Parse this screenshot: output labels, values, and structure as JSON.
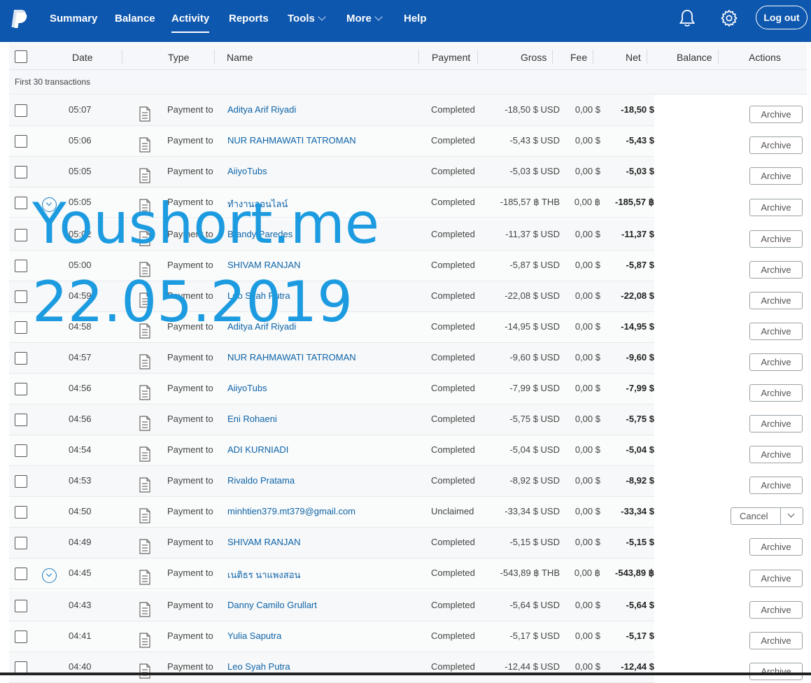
{
  "nav": {
    "items": [
      {
        "label": "Summary",
        "active": false,
        "dropdown": false
      },
      {
        "label": "Balance",
        "active": false,
        "dropdown": false
      },
      {
        "label": "Activity",
        "active": true,
        "dropdown": false
      },
      {
        "label": "Reports",
        "active": false,
        "dropdown": false
      },
      {
        "label": "Tools",
        "active": false,
        "dropdown": true
      },
      {
        "label": "More",
        "active": false,
        "dropdown": true
      },
      {
        "label": "Help",
        "active": false,
        "dropdown": false
      }
    ],
    "icons": [
      "paypal-logo-icon",
      "bell-icon",
      "gear-icon"
    ],
    "logout_label": "Log out",
    "bar_color": "#0e57ae"
  },
  "table": {
    "headers": {
      "date": "Date",
      "type": "Type",
      "name": "Name",
      "payment": "Payment",
      "gross": "Gross",
      "fee": "Fee",
      "net": "Net",
      "balance": "Balance",
      "actions": "Actions"
    },
    "subheader": "First 30 transactions",
    "rows": [
      {
        "time": "05:07",
        "type": "Payment to",
        "name": "Aditya Arif Riyadi",
        "status": "Completed",
        "gross": "-18,50 $ USD",
        "fee": "0,00 $",
        "net": "-18,50 $",
        "action": "Archive",
        "expandable": false
      },
      {
        "time": "05:06",
        "type": "Payment to",
        "name": "NUR RAHMAWATI TATROMAN",
        "status": "Completed",
        "gross": "-5,43 $ USD",
        "fee": "0,00 $",
        "net": "-5,43 $",
        "action": "Archive",
        "expandable": false
      },
      {
        "time": "05:05",
        "type": "Payment to",
        "name": "AiiyoTubs",
        "status": "Completed",
        "gross": "-5,03 $ USD",
        "fee": "0,00 $",
        "net": "-5,03 $",
        "action": "Archive",
        "expandable": false
      },
      {
        "time": "05:05",
        "type": "Payment to",
        "name": "ทำงานออนไลน์",
        "status": "Completed",
        "gross": "-185,57 ฿ THB",
        "fee": "0,00 ฿",
        "net": "-185,57 ฿",
        "action": "Archive",
        "expandable": true
      },
      {
        "time": "05:02",
        "type": "Payment to",
        "name": "Brandy Paredes",
        "status": "Completed",
        "gross": "-11,37 $ USD",
        "fee": "0,00 $",
        "net": "-11,37 $",
        "action": "Archive",
        "expandable": false
      },
      {
        "time": "05:00",
        "type": "Payment to",
        "name": "SHIVAM RANJAN",
        "status": "Completed",
        "gross": "-5,87 $ USD",
        "fee": "0,00 $",
        "net": "-5,87 $",
        "action": "Archive",
        "expandable": false
      },
      {
        "time": "04:59",
        "type": "Payment to",
        "name": "Leo Syah Putra",
        "status": "Completed",
        "gross": "-22,08 $ USD",
        "fee": "0,00 $",
        "net": "-22,08 $",
        "action": "Archive",
        "expandable": false
      },
      {
        "time": "04:58",
        "type": "Payment to",
        "name": "Aditya Arif Riyadi",
        "status": "Completed",
        "gross": "-14,95 $ USD",
        "fee": "0,00 $",
        "net": "-14,95 $",
        "action": "Archive",
        "expandable": false
      },
      {
        "time": "04:57",
        "type": "Payment to",
        "name": "NUR RAHMAWATI TATROMAN",
        "status": "Completed",
        "gross": "-9,60 $ USD",
        "fee": "0,00 $",
        "net": "-9,60 $",
        "action": "Archive",
        "expandable": false
      },
      {
        "time": "04:56",
        "type": "Payment to",
        "name": "AiiyoTubs",
        "status": "Completed",
        "gross": "-7,99 $ USD",
        "fee": "0,00 $",
        "net": "-7,99 $",
        "action": "Archive",
        "expandable": false
      },
      {
        "time": "04:56",
        "type": "Payment to",
        "name": "Eni Rohaeni",
        "status": "Completed",
        "gross": "-5,75 $ USD",
        "fee": "0,00 $",
        "net": "-5,75 $",
        "action": "Archive",
        "expandable": false
      },
      {
        "time": "04:54",
        "type": "Payment to",
        "name": "ADI KURNIADI",
        "status": "Completed",
        "gross": "-5,04 $ USD",
        "fee": "0,00 $",
        "net": "-5,04 $",
        "action": "Archive",
        "expandable": false
      },
      {
        "time": "04:53",
        "type": "Payment to",
        "name": "Rivaldo Pratama",
        "status": "Completed",
        "gross": "-8,92 $ USD",
        "fee": "0,00 $",
        "net": "-8,92 $",
        "action": "Archive",
        "expandable": false
      },
      {
        "time": "04:50",
        "type": "Payment to",
        "name": "minhtien379.mt379@gmail.com",
        "status": "Unclaimed",
        "gross": "-33,34 $ USD",
        "fee": "0,00 $",
        "net": "-33,34 $",
        "action": "Cancel",
        "expandable": false
      },
      {
        "time": "04:49",
        "type": "Payment to",
        "name": "SHIVAM RANJAN",
        "status": "Completed",
        "gross": "-5,15 $ USD",
        "fee": "0,00 $",
        "net": "-5,15 $",
        "action": "Archive",
        "expandable": false
      },
      {
        "time": "04:45",
        "type": "Payment to",
        "name": "เนติธร นาแพงสอน",
        "status": "Completed",
        "gross": "-543,89 ฿ THB",
        "fee": "0,00 ฿",
        "net": "-543,89 ฿",
        "action": "Archive",
        "expandable": true
      },
      {
        "time": "04:43",
        "type": "Payment to",
        "name": "Danny Camilo Grullart",
        "status": "Completed",
        "gross": "-5,64 $ USD",
        "fee": "0,00 $",
        "net": "-5,64 $",
        "action": "Archive",
        "expandable": false
      },
      {
        "time": "04:41",
        "type": "Payment to",
        "name": "Yulia Saputra",
        "status": "Completed",
        "gross": "-5,17 $ USD",
        "fee": "0,00 $",
        "net": "-5,17 $",
        "action": "Archive",
        "expandable": false
      },
      {
        "time": "04:40",
        "type": "Payment to",
        "name": "Leo Syah Putra",
        "status": "Completed",
        "gross": "-12,44 $ USD",
        "fee": "0,00 $",
        "net": "-12,44 $",
        "action": "Archive",
        "expandable": false
      }
    ]
  },
  "watermark": {
    "line1": "Youshort.me",
    "line2": "22.05.2019",
    "color": "#1c9be0"
  }
}
